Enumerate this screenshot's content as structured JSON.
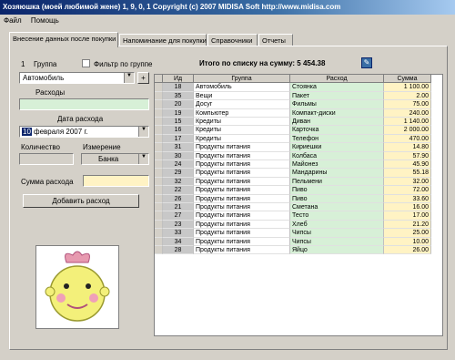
{
  "window": {
    "title": "Хозяюшка (моей любимой жене) 1, 9, 0, 1 Copyright (c) 2007 MIDISA Soft http://www.midisa.com"
  },
  "menu": [
    "Файл",
    "Помощь"
  ],
  "tabs": [
    "Внесение данных после покупки",
    "Напоминание для покупки",
    "Справочники",
    "Отчеты"
  ],
  "form": {
    "group_number": "1",
    "group_label": "Группа",
    "filter_label": "Фильтр по группе",
    "group_value": "Автомобиль",
    "add_group": "+",
    "expenses_label": "Расходы",
    "expenses_value": "",
    "date_label": "Дата расхода",
    "date_day": "10",
    "date_rest": " февраля 2007 г.",
    "qty_label": "Количество",
    "unit_label": "Измерение",
    "unit_value": "Банка",
    "amount_label": "Сумма расхода",
    "add_button": "Добавить расход"
  },
  "summary": {
    "total_label": "Итого по списку на сумму: 5 454.38"
  },
  "icons": {
    "tool": "wrench-icon",
    "mascot": "face-icon"
  },
  "grid": {
    "headers": [
      "Ид",
      "Группа",
      "Расход",
      "Сумма"
    ],
    "rows": [
      [
        "18",
        "Автомобиль",
        "Стоянка",
        "1 100.00"
      ],
      [
        "35",
        "Вещи",
        "Пакет",
        "2.00"
      ],
      [
        "20",
        "Досуг",
        "Фильмы",
        "75.00"
      ],
      [
        "19",
        "Компьютер",
        "Компакт-диски",
        "240.00"
      ],
      [
        "15",
        "Кредиты",
        "Диван",
        "1 140.00"
      ],
      [
        "16",
        "Кредиты",
        "Карточка",
        "2 000.00"
      ],
      [
        "17",
        "Кредиты",
        "Телефон",
        "470.00"
      ],
      [
        "31",
        "Продукты питания",
        "Кириешки",
        "14.80"
      ],
      [
        "30",
        "Продукты питания",
        "Колбаса",
        "57.90"
      ],
      [
        "24",
        "Продукты питания",
        "Майонез",
        "45.90"
      ],
      [
        "29",
        "Продукты питания",
        "Мандарины",
        "55.18"
      ],
      [
        "32",
        "Продукты питания",
        "Пельмени",
        "32.00"
      ],
      [
        "22",
        "Продукты питания",
        "Пиво",
        "72.00"
      ],
      [
        "26",
        "Продукты питания",
        "Пиво",
        "33.60"
      ],
      [
        "21",
        "Продукты питания",
        "Сметана",
        "16.00"
      ],
      [
        "27",
        "Продукты питания",
        "Тесто",
        "17.00"
      ],
      [
        "23",
        "Продукты питания",
        "Хлеб",
        "21.20"
      ],
      [
        "33",
        "Продукты питания",
        "Чипсы",
        "25.00"
      ],
      [
        "34",
        "Продукты питания",
        "Чипсы",
        "10.00"
      ],
      [
        "28",
        "Продукты питания",
        "Яйцо",
        "26.00"
      ]
    ]
  }
}
